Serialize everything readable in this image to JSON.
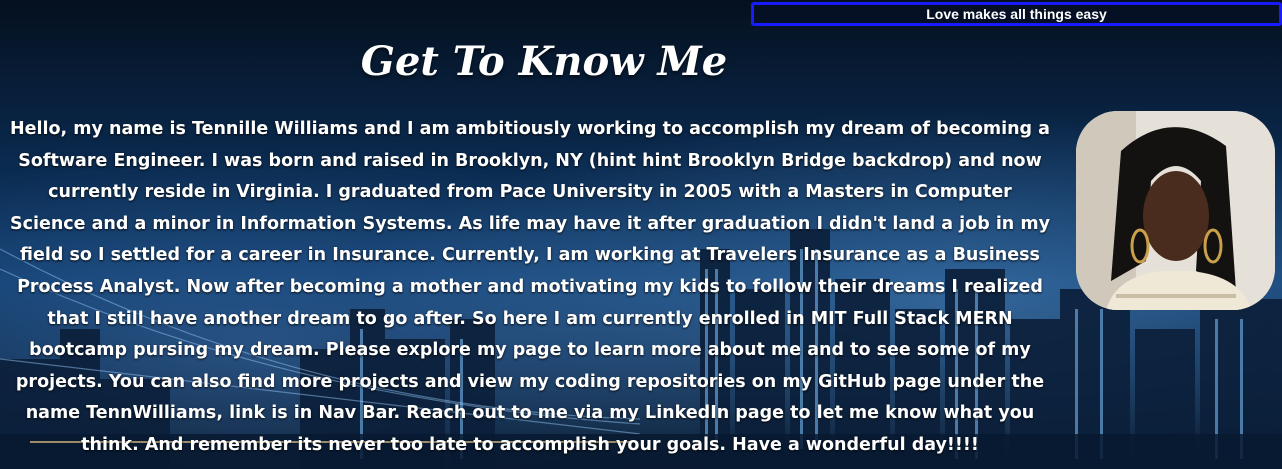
{
  "header": {
    "quote": "Love makes all things easy"
  },
  "about": {
    "title": "Get To Know Me",
    "bio": "Hello, my name is Tennille Williams and I am ambitiously working to accomplish my dream of becoming a Software Engineer. I was born and raised in Brooklyn, NY (hint hint Brooklyn Bridge backdrop) and now currently reside in Virginia. I graduated from Pace University in 2005 with a Masters in Computer Science and a minor in Information Systems. As life may have it after graduation I didn't land a job in my field so I settled for a career in Insurance. Currently, I am working at Travelers Insurance as a Business Process Analyst. Now after becoming a mother and motivating my kids to follow their dreams I realized that I still have another dream to go after. So here I am currently enrolled in MIT Full Stack MERN bootcamp pursing my dream. Please explore my page to learn more about me and to see some of my projects. You can also find more projects and view my coding repositories on my GitHub page under the name TennWilliams, link is in Nav Bar. Reach out to me via my LinkedIn page to let me know what you think. And remember its never too late to accomplish your goals. Have a wonderful day!!!!"
  },
  "colors": {
    "banner_border": "#1a1aff",
    "text": "#ffffff",
    "background": "#0a2a4f"
  }
}
